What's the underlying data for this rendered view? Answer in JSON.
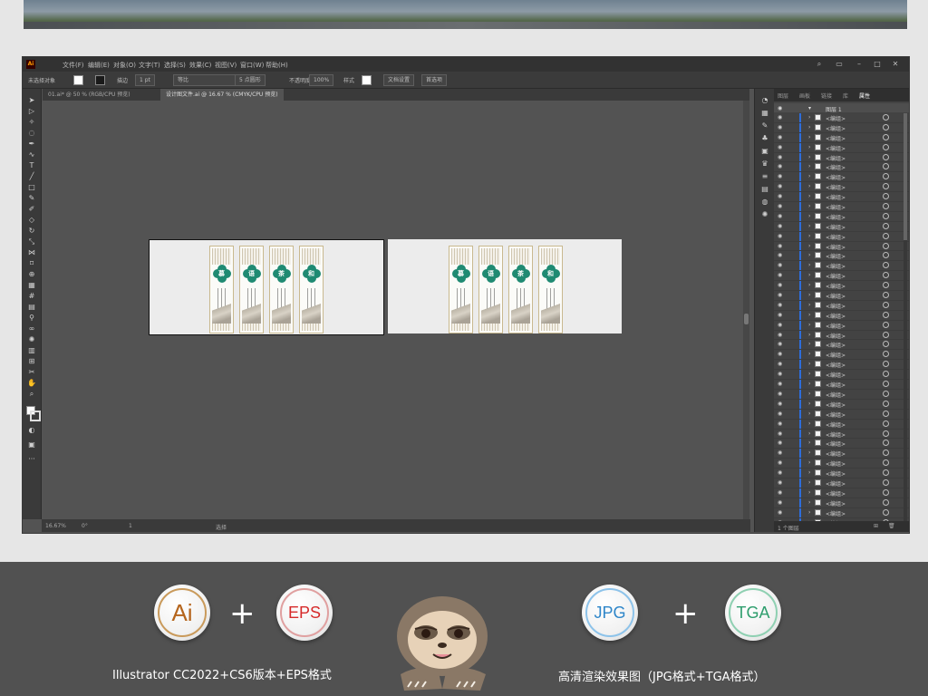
{
  "app": {
    "logo": "Ai",
    "menu": [
      "文件(F)",
      "编辑(E)",
      "对象(O)",
      "文字(T)",
      "选择(S)",
      "效果(C)",
      "视图(V)",
      "窗口(W)",
      "帮助(H)"
    ]
  },
  "controlbar": {
    "selection": "未选择对象",
    "stroke_label": "描边",
    "stroke_value": "1 pt",
    "brush": "等比",
    "style": "5 点圆形",
    "opacity_label": "不透明度",
    "opacity_value": "100%",
    "styles_label": "样式",
    "doc_setup": "文档设置",
    "prefs": "首选项"
  },
  "tabs": [
    {
      "label": "01.ai* @ 50 % (RGB/CPU 预览)",
      "active": false
    },
    {
      "label": "设计图文件.ai @ 16.67 % (CMYK/CPU 预览)",
      "active": true
    }
  ],
  "panels": {
    "artboard1": [
      "慕",
      "语",
      "茶",
      "和"
    ],
    "artboard2": [
      "慕",
      "语",
      "茶",
      "和"
    ]
  },
  "statusbar": {
    "zoom": "16.67%",
    "rotation": "0°",
    "artboard_num": "1",
    "tool": "选择"
  },
  "layers": {
    "tabs": [
      "图层",
      "画板",
      "链接",
      "库",
      "属性"
    ],
    "active_tab": "图层",
    "layer_name": "图层 1",
    "item_label": "<编组>",
    "rows": 42,
    "footer": "1 个图层"
  },
  "bottom": {
    "badges": [
      "Ai",
      "EPS",
      "JPG",
      "TGA"
    ],
    "plus": "+",
    "caption_left": "Illustrator CC2022+CS6版本+EPS格式",
    "caption_right": "高清渲染效果图（JPG格式+TGA格式）",
    "colors": {
      "ai": "#b5651d",
      "eps": "#d62b2b",
      "jpg": "#2e86c9",
      "tga": "#2f9e6e"
    }
  }
}
